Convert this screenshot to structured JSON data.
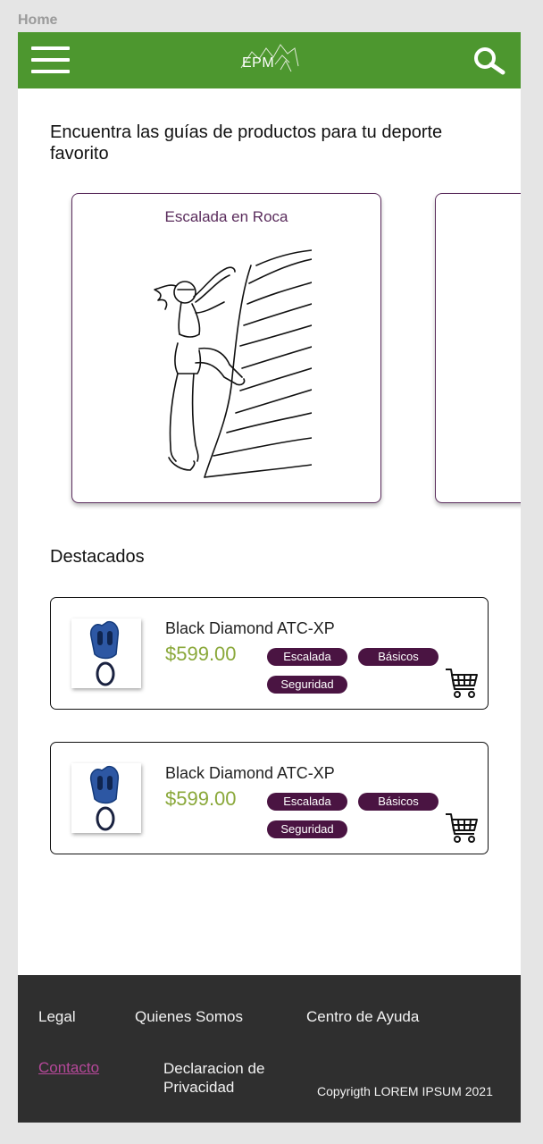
{
  "frame": {
    "label": "Home"
  },
  "header": {
    "logo_text": "EPM",
    "menu_icon": "hamburger-menu-icon",
    "search_icon": "search-icon",
    "background_color": "#4d972f"
  },
  "guides": {
    "heading": "Encuentra las guías de productos para tu deporte favorito",
    "cards": [
      {
        "title": "Escalada en Roca",
        "illustration": "rock-climber-illustration"
      },
      {
        "title": ""
      }
    ]
  },
  "featured": {
    "heading": "Destacados",
    "products": [
      {
        "name": "Black Diamond ATC-XP",
        "price": "$599.00",
        "tags": [
          "Escalada",
          "Básicos",
          "Seguridad"
        ],
        "image_icon": "belay-device-icon",
        "cart_icon": "cart-icon"
      },
      {
        "name": "Black Diamond ATC-XP",
        "price": "$599.00",
        "tags": [
          "Escalada",
          "Básicos",
          "Seguridad"
        ],
        "image_icon": "belay-device-icon",
        "cart_icon": "cart-icon"
      }
    ]
  },
  "footer": {
    "legal": "Legal",
    "quienes": "Quienes Somos",
    "ayuda": "Centro de Ayuda",
    "contacto": "Contacto",
    "declaracion_1": "Declaracion de",
    "declaracion_2": "Privacidad",
    "copyright": "Copyrigth LOREM IPSUM 2021"
  },
  "colors": {
    "accent_green": "#4d972f",
    "tag_purple": "#4a1442",
    "price_green": "#8aa83a",
    "card_border": "#5a2c5c",
    "footer_bg": "#2f2f2f",
    "link_pink": "#b6489a"
  }
}
